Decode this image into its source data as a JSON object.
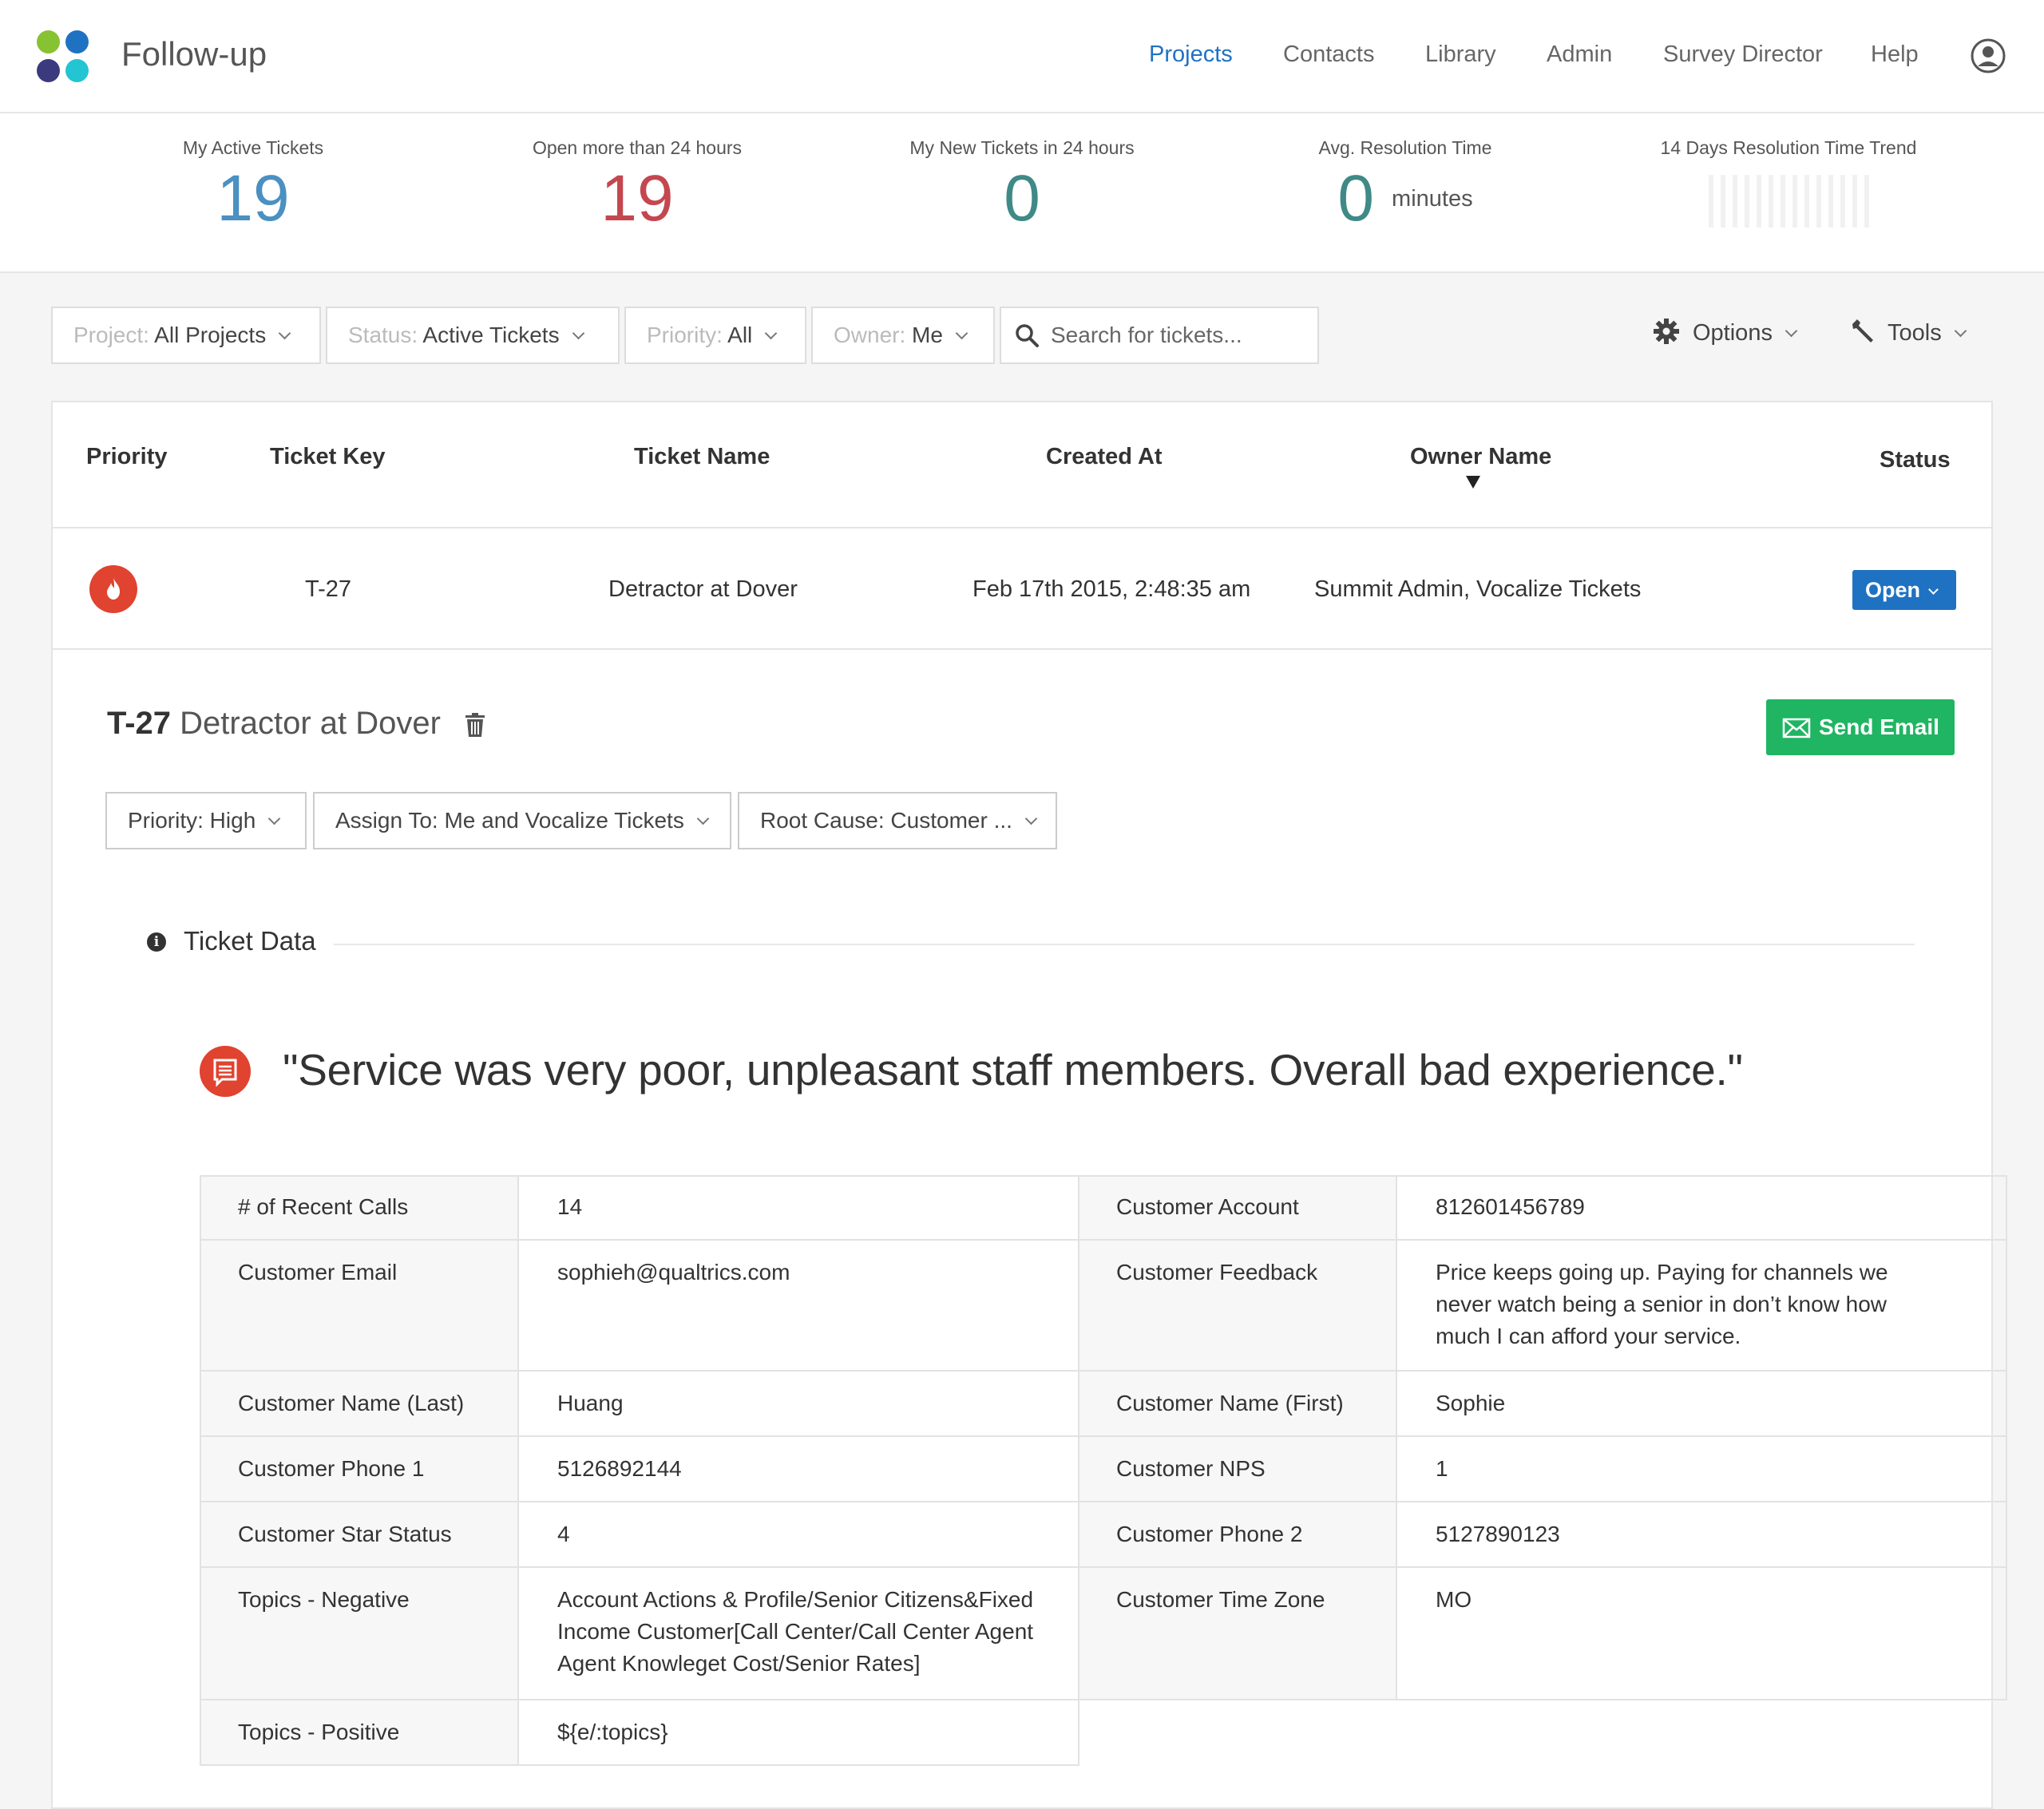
{
  "app": {
    "brand": "Follow-up",
    "nav": [
      "Projects",
      "Contacts",
      "Library",
      "Admin",
      "Survey Director",
      "Help"
    ],
    "active_nav": "Projects",
    "logo_colors": [
      "#86c232",
      "#1f72c2",
      "#3c3a7e",
      "#22c5d1"
    ]
  },
  "metrics": {
    "active_label": "My Active Tickets",
    "active_value": "19",
    "open_label": "Open more than 24 hours",
    "open_value": "19",
    "new_label": "My New Tickets in 24 hours",
    "new_value": "0",
    "avg_label": "Avg. Resolution Time",
    "avg_value": "0",
    "avg_unit": "minutes",
    "trend_label": "14 Days Resolution Time Trend"
  },
  "filters": {
    "project_key": "Project:",
    "project_val": "All Projects",
    "status_key": "Status:",
    "status_val": "Active Tickets",
    "priority_key": "Priority:",
    "priority_val": "All",
    "owner_key": "Owner:",
    "owner_val": "Me",
    "search_placeholder": "Search for tickets...",
    "options_label": "Options",
    "tools_label": "Tools"
  },
  "table": {
    "headers": [
      "Priority",
      "Ticket Key",
      "Ticket Name",
      "Created At",
      "Owner Name",
      "Status"
    ],
    "row": {
      "key": "T-27",
      "name": "Detractor at Dover",
      "created": "Feb 17th 2015, 2:48:35 am",
      "owner": "Summit Admin, Vocalize Tickets",
      "status": "Open"
    }
  },
  "detail": {
    "key": "T-27",
    "name": "Detractor at Dover",
    "send_email": "Send Email",
    "priority_dd": "Priority: High",
    "assign_dd": "Assign To: Me and Vocalize Tickets",
    "root_cause_dd": "Root Cause: Customer ...",
    "section_title": "Ticket Data",
    "quote": "\"Service was very poor, unpleasant staff members. Overall bad experience.\""
  },
  "ticket_data": {
    "left": [
      {
        "label": "# of Recent Calls",
        "value": "14"
      },
      {
        "label": "Customer Email",
        "value": "sophieh@qualtrics.com"
      },
      {
        "label": "Customer Name (Last)",
        "value": "Huang"
      },
      {
        "label": "Customer Phone 1",
        "value": "5126892144"
      },
      {
        "label": "Customer Star Status",
        "value": "4"
      },
      {
        "label": "Topics - Negative",
        "value": "Account Actions & Profile/Senior Citizens&Fixed Income Customer[Call Center/Call Center Agent Agent Knowleget Cost/Senior Rates]"
      },
      {
        "label": "Topics - Positive",
        "value": "${e/:topics}"
      }
    ],
    "right": [
      {
        "label": "Customer Account",
        "value": "812601456789"
      },
      {
        "label": "Customer Feedback",
        "value": "Price keeps going up. Paying for channels we never watch being a senior in don’t know how much I can afford your service."
      },
      {
        "label": "Customer Name (First)",
        "value": "Sophie"
      },
      {
        "label": "Customer NPS",
        "value": "1"
      },
      {
        "label": "Customer Phone 2",
        "value": "5127890123"
      },
      {
        "label": "Customer Time Zone",
        "value": "MO"
      }
    ]
  },
  "colors": {
    "accent_blue": "#1f72c2",
    "metric_blue": "#4a90c2",
    "metric_red": "#c4474f",
    "metric_teal": "#3f8a86",
    "send_green": "#1fb562",
    "priority_red": "#e0432f"
  }
}
